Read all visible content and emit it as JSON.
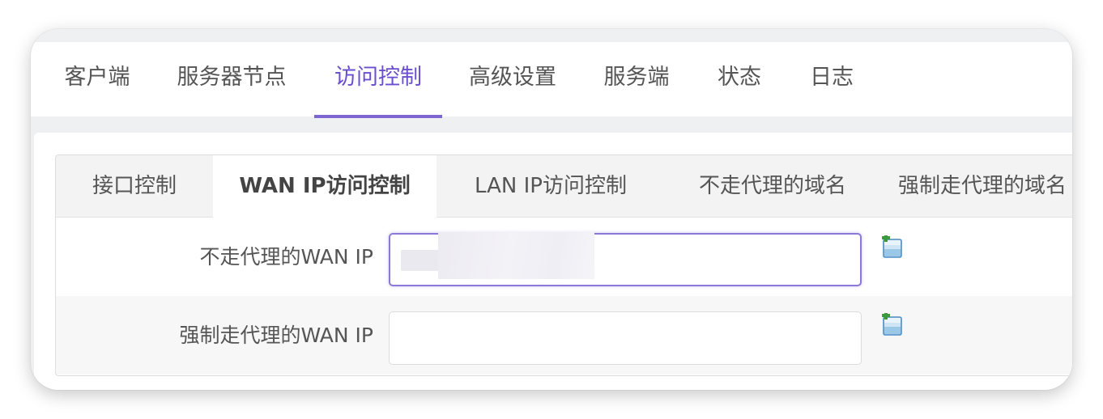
{
  "top_nav": {
    "items": [
      {
        "label": "客户端"
      },
      {
        "label": "服务器节点"
      },
      {
        "label": "访问控制"
      },
      {
        "label": "高级设置"
      },
      {
        "label": "服务端"
      },
      {
        "label": "状态"
      },
      {
        "label": "日志"
      }
    ],
    "active": "访问控制"
  },
  "sub_tabs": {
    "items": [
      {
        "label": "接口控制"
      },
      {
        "label": "WAN IP访问控制"
      },
      {
        "label": "LAN IP访问控制"
      },
      {
        "label": "不走代理的域名"
      },
      {
        "label": "强制走代理的域名"
      }
    ],
    "active": "WAN IP访问控制"
  },
  "form": {
    "rows": [
      {
        "label": "不走代理的WAN IP",
        "value": "",
        "placeholder": "",
        "icon": "add-entry-icon"
      },
      {
        "label": "强制走代理的WAN IP",
        "value": "",
        "placeholder": "",
        "icon": "add-entry-icon"
      }
    ]
  },
  "colors": {
    "accent": "#6c4fd0",
    "underline": "#7e66d1",
    "focus_border": "#8c78d9"
  }
}
